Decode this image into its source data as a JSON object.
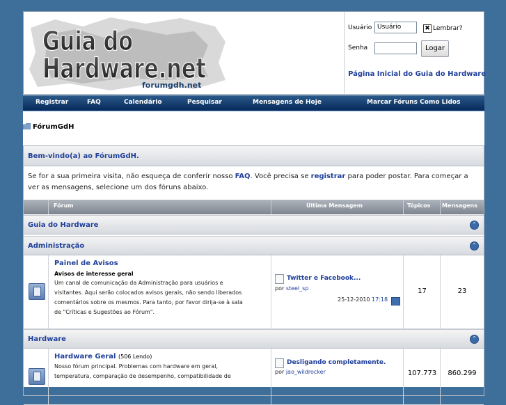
{
  "header": {
    "logo": {
      "line1": "Guia do",
      "line2": "Hardware.net",
      "sub": "forumgdh.net"
    },
    "login": {
      "user_label": "Usuário",
      "user_value": "Usuário",
      "remember_label": "Lembrar?",
      "pass_label": "Senha",
      "login_button": "Logar",
      "home_link": "Página Inicial do Guia do Hardware"
    }
  },
  "nav": [
    "Registrar",
    "FAQ",
    "Calendário",
    "Pesquisar",
    "Mensagens de Hoje",
    "Marcar Fóruns Como Lidos"
  ],
  "breadcrumb": "FórumGdH",
  "welcome": {
    "title": "Bem-vindo(a) ao FórumGdH.",
    "intro_1": "Se for a sua primeira visita, não esqueça de conferir nosso ",
    "faq": "FAQ",
    "intro_2": ". Você precisa se ",
    "registrar": "registrar",
    "intro_3": " para poder postar. Para começar a ver as mensagens, selecione um dos fóruns abaixo."
  },
  "table_header": {
    "forum": "Fórum",
    "last": "Última Mensagem",
    "topics": "Tópicos",
    "posts": "Mensagens"
  },
  "categories": {
    "c1": "Guia do Hardware",
    "c2": "Administração",
    "c3": "Hardware"
  },
  "forums": {
    "avisos": {
      "title": "Painel de Avisos",
      "subtitle": "Avisos de interesse geral",
      "desc_1": "Um canal de comunicação da Administração para usuários e",
      "desc_2": "visitantes. Aqui serão colocados avisos gerais, não sendo liberados",
      "desc_3": "comentários sobre os mesmos. Para tanto, por favor dirija-se à sala",
      "desc_4": "de \"Críticas e Sugestões ao Fórum\".",
      "last_title": "Twitter e Facebook...",
      "last_by": "por ",
      "last_user": "steel_sp",
      "last_date": "25-12-2010 ",
      "last_time": "17:18",
      "topics": "17",
      "posts": "23"
    },
    "hwgeral": {
      "title": "Hardware Geral",
      "viewing": "(506 Lendo)",
      "desc_1": "Nosso fórum principal. Problemas com hardware em geral,",
      "desc_2": "temperatura, comparação de desempenho, compatibilidade de",
      "last_title": "Desligando completamente.",
      "last_by": "por ",
      "last_user": "jao_wildrocker",
      "topics": "107.773",
      "posts": "860.299"
    }
  },
  "colors": {
    "background": "#3e6f9a",
    "link": "#1f3f9a",
    "nav": "#07285a"
  }
}
